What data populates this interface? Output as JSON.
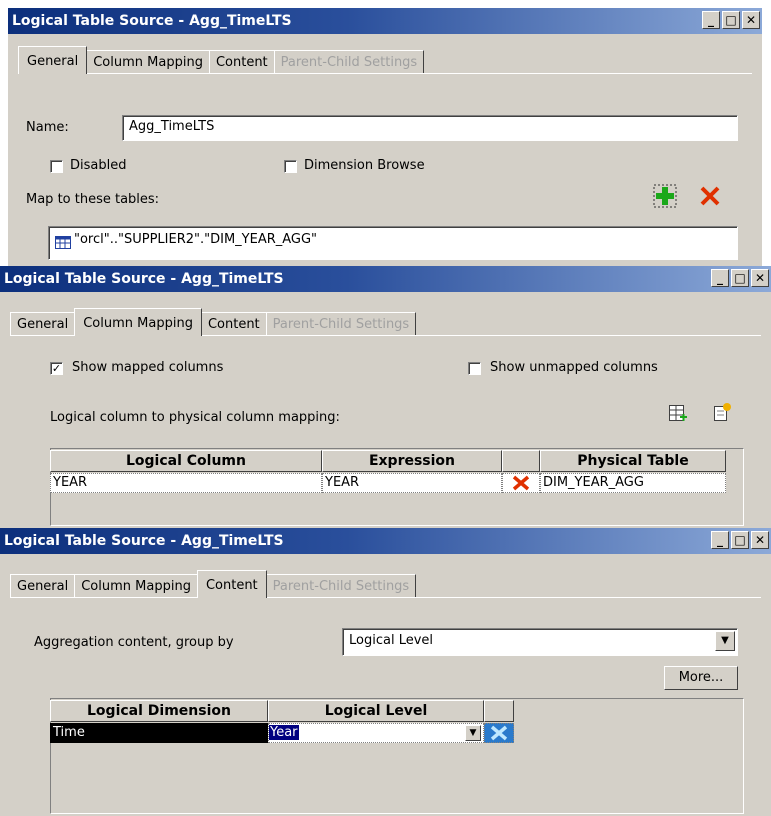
{
  "win1": {
    "title": "Logical Table Source - Agg_TimeLTS",
    "tabs": [
      "General",
      "Column Mapping",
      "Content",
      "Parent-Child Settings"
    ],
    "name_label": "Name:",
    "name_value": "Agg_TimeLTS",
    "disabled_label": "Disabled",
    "dimension_browse_label": "Dimension Browse",
    "map_label": "Map to these tables:",
    "table_entry": "\"orcl\"..\"SUPPLIER2\".\"DIM_YEAR_AGG\""
  },
  "win2": {
    "title": "Logical Table Source - Agg_TimeLTS",
    "tabs": [
      "General",
      "Column Mapping",
      "Content",
      "Parent-Child Settings"
    ],
    "show_mapped_label": "Show mapped columns",
    "show_mapped_checked": true,
    "show_unmapped_label": "Show unmapped columns",
    "show_unmapped_checked": false,
    "mapping_label": "Logical column to physical column mapping:",
    "columns": [
      "Logical Column",
      "Expression",
      "",
      "Physical Table"
    ],
    "rows": [
      {
        "logical_column": "YEAR",
        "expression": "YEAR",
        "physical_table": "DIM_YEAR_AGG"
      }
    ]
  },
  "win3": {
    "title": "Logical Table Source - Agg_TimeLTS",
    "tabs": [
      "General",
      "Column Mapping",
      "Content",
      "Parent-Child Settings"
    ],
    "aggregation_label": "Aggregation content, group by",
    "aggregation_value": "Logical Level",
    "more_button": "More...",
    "columns": [
      "Logical Dimension",
      "Logical Level"
    ],
    "rows": [
      {
        "logical_dimension": "Time",
        "logical_level": "Year"
      }
    ]
  },
  "colors": {
    "titlebar_start": "#0c2f7c",
    "titlebar_end": "#8ca9d8",
    "dialog_bg": "#d4d0c8",
    "selection": "#000080",
    "delete_red": "#e03000",
    "add_green": "#1aa81a"
  },
  "icons": [
    "minimize-icon",
    "maximize-icon",
    "close-icon",
    "add-table-icon",
    "delete-icon",
    "table-icon",
    "column-mapping-icon",
    "new-column-icon",
    "dropdown-arrow-icon"
  ]
}
